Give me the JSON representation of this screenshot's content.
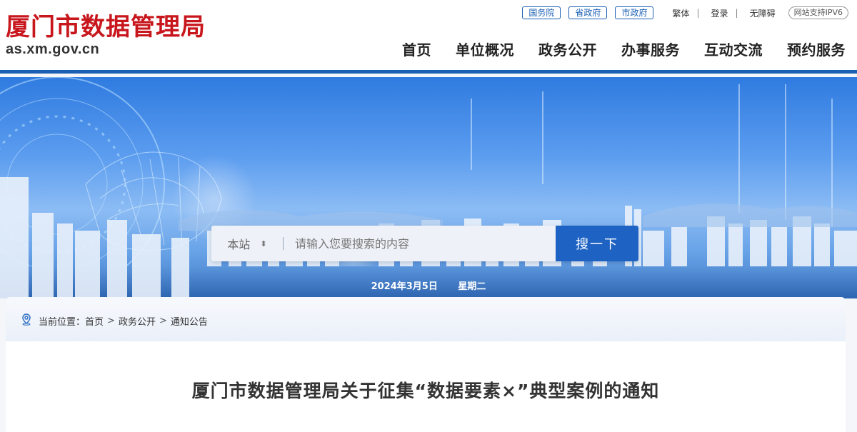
{
  "site": {
    "title": "厦门市数据管理局",
    "url": "as.xm.gov.cn"
  },
  "top_links": {
    "gov_links": [
      "国务院",
      "省政府",
      "市政府"
    ],
    "traditional": "繁体",
    "login": "登录",
    "accessible": "无障碍",
    "ipv6": "网站支持IPV6",
    "separator": "|"
  },
  "nav": [
    "首页",
    "单位概况",
    "政务公开",
    "办事服务",
    "互动交流",
    "预约服务"
  ],
  "search": {
    "scope": "本站",
    "placeholder": "请输入您要搜索的内容",
    "button": "搜一下"
  },
  "date": {
    "date": "2024年3月5日",
    "weekday": "星期二"
  },
  "breadcrumb": {
    "label": "当前位置：",
    "items": [
      "首页",
      "政务公开",
      "通知公告"
    ],
    "separator": ">"
  },
  "article": {
    "title": "厦门市数据管理局关于征集“数据要素×”典型案例的通知"
  },
  "colors": {
    "brand_red": "#c8161d",
    "brand_blue": "#1a5fb4"
  }
}
